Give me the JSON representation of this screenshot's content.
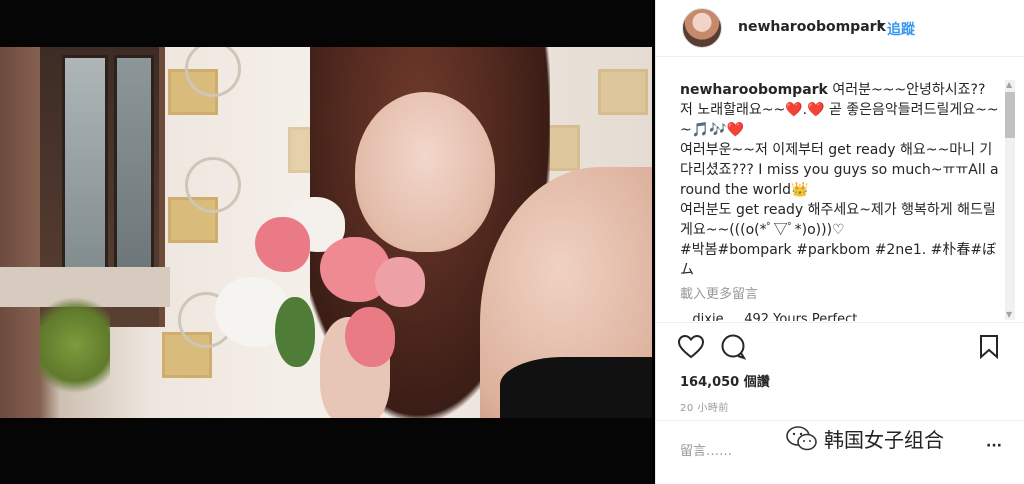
{
  "post": {
    "username": "newharoobompark",
    "separator": "•",
    "follow_label": "追蹤",
    "caption_user": "newharoobompark",
    "caption_text": " 여러분~~~안녕하시죠?? 저 노래할래요~~❤️.❤️ 곧 좋은음악들려드릴게요~~~🎵🎶❤️\n여러부운~~저 이제부터 get ready 해요~~마니 기다리셨죠??? I miss you guys so much~ㅠㅠAll around the world👑\n여러분도 get ready 해주세요~제가 행복하게 해드릴게요~~(((o(*ﾟ▽ﾟ*)o)))♡\n#박봄#bompark #parkbom #2ne1. #朴春#ぼム",
    "load_more": "載入更多留言",
    "partial_comment": "...dixie ... 492 Yours Perfect...",
    "likes": "164,050 個讚",
    "time": "20 小時前",
    "comment_placeholder": "留言……",
    "more_options": "···"
  },
  "watermark": {
    "text": "韩国女子组合"
  },
  "colors": {
    "link": "#3897f0",
    "text": "#262626",
    "muted": "#999999"
  }
}
